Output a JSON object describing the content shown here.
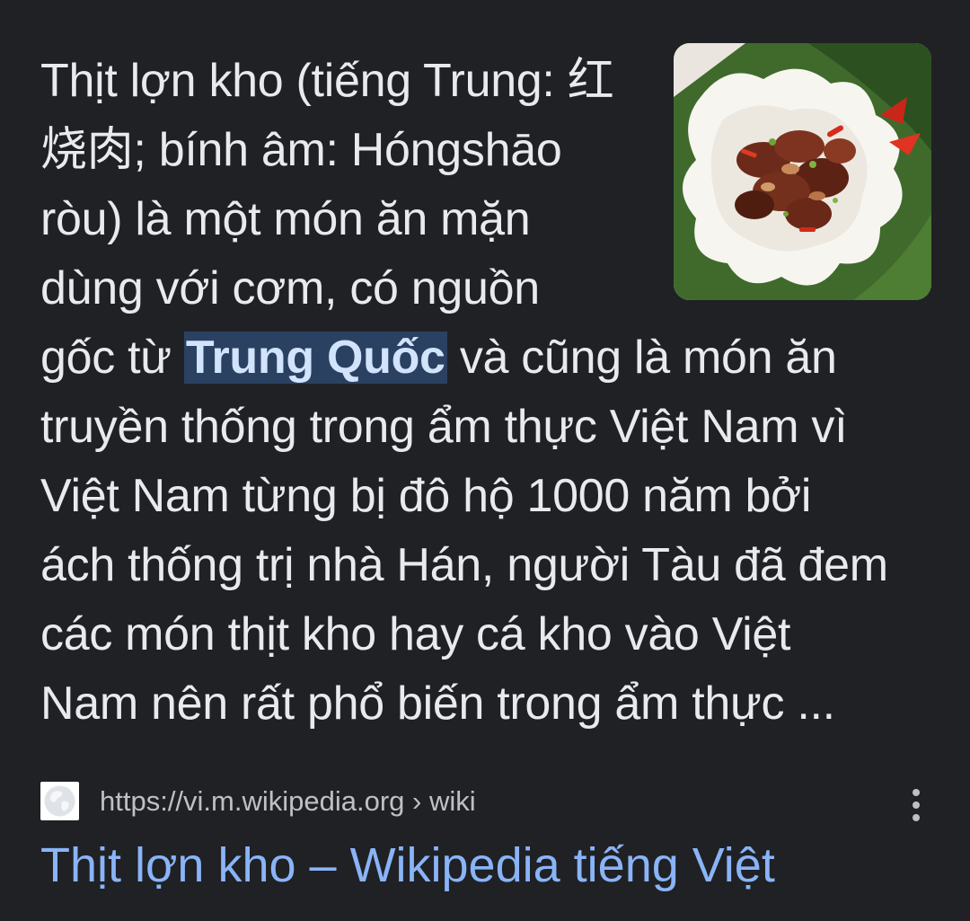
{
  "snippet": {
    "lines": [
      "Thịt lợn kho (tiếng Trung: 红",
      "烧肉; bính âm: Hóngshāo",
      "ròu) là một món ăn mặn",
      "dùng với cơm, có nguồn"
    ],
    "line5_before": "gốc từ ",
    "line5_highlight": "Trung Quốc",
    "line5_after": " và cũng là món ăn",
    "rest_lines": [
      "truyền thống trong ẩm thực Việt Nam vì",
      "Việt Nam từng bị đô hộ 1000 năm bởi",
      "ách thống trị nhà Hán, người Tàu đã đem",
      "các món thịt kho hay cá kho vào Việt",
      "Nam nên rất phổ biến trong ẩm thực ..."
    ]
  },
  "thumbnail": {
    "icon": "food-photo"
  },
  "source": {
    "favicon": "globe-icon",
    "url": "https://vi.m.wikipedia.org › wiki"
  },
  "result": {
    "title": "Thịt lợn kho – Wikipedia tiếng Việt"
  },
  "colors": {
    "background": "#202124",
    "text": "#e8eaed",
    "link": "#8ab4f8",
    "highlight_bg": "#2b4161"
  }
}
